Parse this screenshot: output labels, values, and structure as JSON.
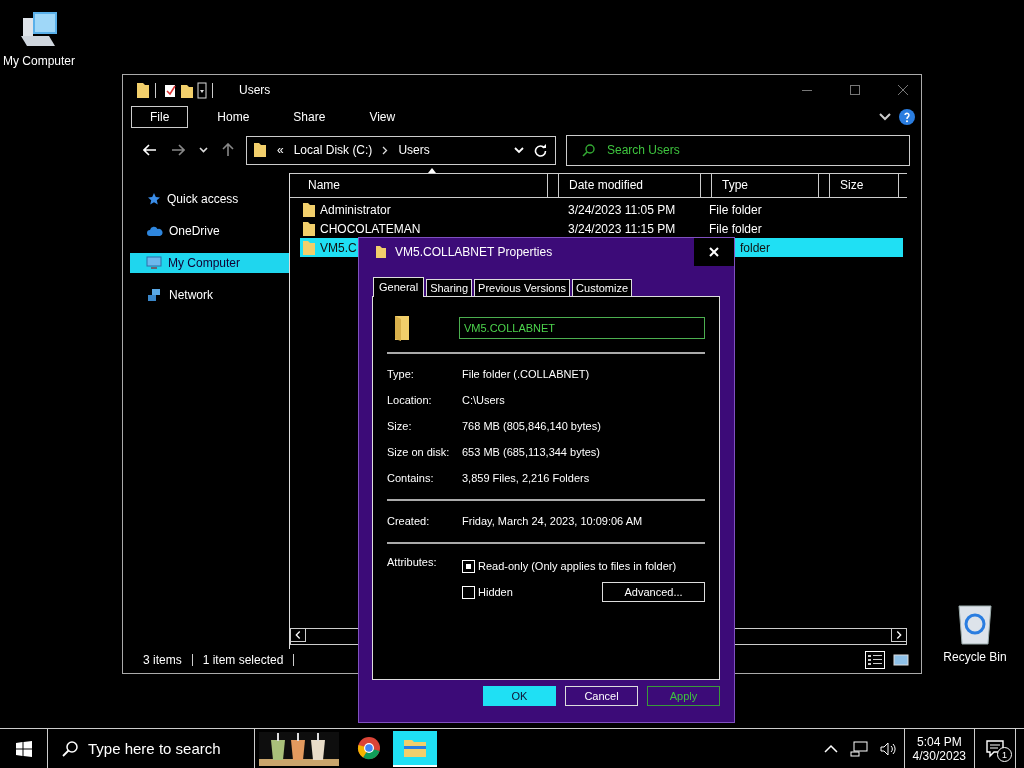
{
  "desktop_icons": [
    {
      "kind": "computer",
      "label": "My Computer"
    },
    {
      "kind": "recycle-bin",
      "label": "Recycle Bin"
    }
  ],
  "explorer": {
    "title": "Users",
    "ribbon_tabs": [
      {
        "label": "File",
        "selected": true
      },
      {
        "label": "Home",
        "selected": false
      },
      {
        "label": "Share",
        "selected": false
      },
      {
        "label": "View",
        "selected": false
      }
    ],
    "address": {
      "prefix": "«",
      "path": [
        "Local Disk (C:)",
        "Users"
      ]
    },
    "search": {
      "placeholder": "Search Users"
    },
    "nav_items": [
      {
        "kind": "star",
        "label": "Quick access",
        "selected": false
      },
      {
        "kind": "cloud",
        "label": "OneDrive",
        "selected": false
      },
      {
        "kind": "computer",
        "label": "My Computer",
        "selected": true
      },
      {
        "kind": "network",
        "label": "Network",
        "selected": false
      }
    ],
    "columns": [
      "Name",
      "Date modified",
      "Type",
      "Size"
    ],
    "rows": [
      {
        "name": "Administrator",
        "date": "3/24/2023 11:05 PM",
        "type": "File folder",
        "selected": false
      },
      {
        "name": "CHOCOLATEMAN",
        "date": "3/24/2023 11:15 PM",
        "type": "File folder",
        "selected": false
      },
      {
        "name": "VM5.C",
        "type": "folder",
        "selected": true
      }
    ],
    "status": [
      "3 items",
      "1 item selected"
    ]
  },
  "dialog": {
    "title": "VM5.COLLABNET Properties",
    "tabs": [
      {
        "label": "General",
        "selected": true
      },
      {
        "label": "Sharing",
        "selected": false
      },
      {
        "label": "Previous Versions",
        "selected": false
      },
      {
        "label": "Customize",
        "selected": false
      }
    ],
    "name": "VM5.COLLABNET",
    "groups": [
      [
        {
          "label": "Type:",
          "value": "File folder (.COLLABNET)"
        },
        {
          "label": "Location:",
          "value": "C:\\Users"
        },
        {
          "label": "Size:",
          "value": "768 MB (805,846,140 bytes)"
        },
        {
          "label": "Size on disk:",
          "value": "653 MB (685,113,344 bytes)"
        },
        {
          "label": "Contains:",
          "value": "3,859 Files, 2,216 Folders"
        }
      ],
      [
        {
          "label": "Created:",
          "value": "Friday, March 24, 2023, 10:09:06 AM"
        }
      ]
    ],
    "attributes_label": "Attributes:",
    "attributes": [
      {
        "label": "Read-only (Only applies to files in folder)",
        "checked": true
      },
      {
        "label": "Hidden",
        "checked": false
      }
    ],
    "advanced": "Advanced...",
    "buttons": [
      {
        "label": "OK",
        "kind": "default"
      },
      {
        "label": "Cancel",
        "kind": "normal"
      },
      {
        "label": "Apply",
        "kind": "focused"
      }
    ]
  },
  "taskbar": {
    "search_placeholder": "Type here to search",
    "apps": [
      {
        "kind": "picture"
      },
      {
        "kind": "chrome",
        "active": false
      },
      {
        "kind": "explorer",
        "active": true
      }
    ],
    "time": "5:04 PM",
    "date": "4/30/2023",
    "notifications": "1"
  }
}
